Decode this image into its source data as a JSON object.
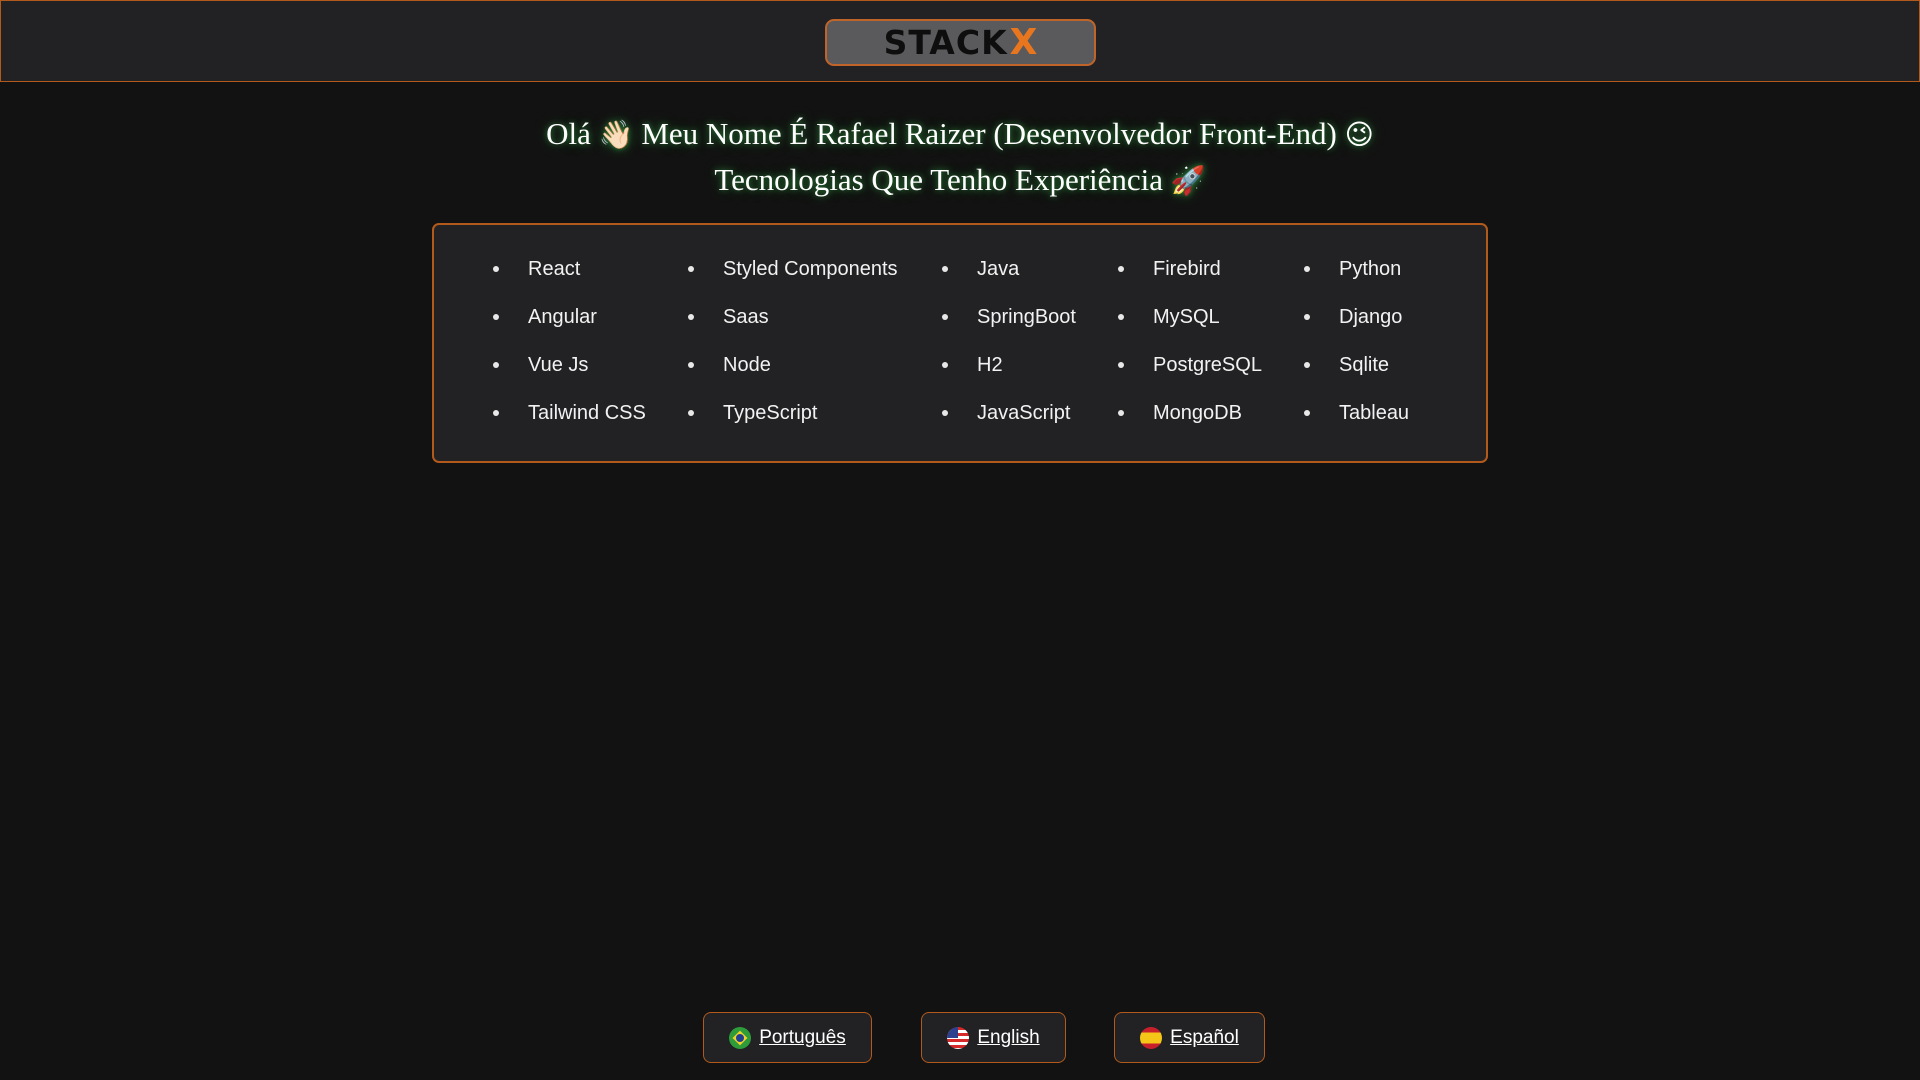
{
  "header": {
    "logo_text": "STACK",
    "logo_accent": "X"
  },
  "headline": {
    "line1_text": "Olá",
    "line1_emoji": "👋🏻",
    "line1_rest": "Meu Nome É Rafael Raizer (Desenvolvedor Front-End)",
    "line1_end_emoji": "😉",
    "line2_text": "Tecnologias Que Tenho Experiência",
    "line2_emoji": "🚀"
  },
  "technologies": {
    "columns": [
      [
        "React",
        "Angular",
        "Vue Js",
        "Tailwind CSS"
      ],
      [
        "Styled Components",
        "Saas",
        "Node",
        "TypeScript"
      ],
      [
        "Java",
        "SpringBoot",
        "H2",
        "JavaScript"
      ],
      [
        "Firebird",
        "MySQL",
        "PostgreSQL",
        "MongoDB"
      ],
      [
        "Python",
        "Django",
        "Sqlite",
        "Tableau"
      ]
    ]
  },
  "languages": [
    {
      "label": "Português",
      "flag": "brazil-flag-icon"
    },
    {
      "label": "English",
      "flag": "us-flag-icon"
    },
    {
      "label": "Español",
      "flag": "spain-flag-icon"
    }
  ],
  "colors": {
    "background": "#121212",
    "panel": "#222224",
    "accent_border": "#b25a1c",
    "logo_accent": "#e8761e",
    "glow": "#3cc850"
  }
}
